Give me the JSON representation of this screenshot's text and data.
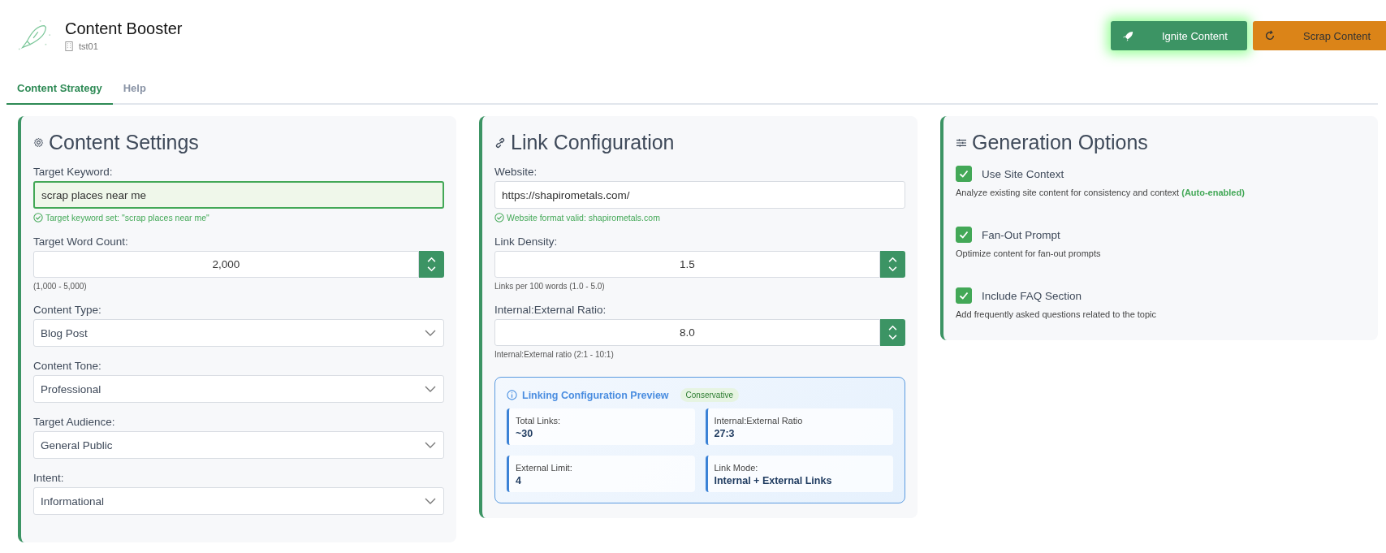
{
  "header": {
    "title": "Content Booster",
    "workspace": "tst01"
  },
  "actions": [
    {
      "label": "Ignite Content",
      "kind": "primary"
    },
    {
      "label": "Scrap Content",
      "kind": "warning"
    }
  ],
  "tabs": [
    {
      "label": "Content Strategy",
      "selected": true
    },
    {
      "label": "Help",
      "selected": false
    }
  ],
  "content_settings": {
    "title": "Content Settings",
    "fields": [
      {
        "kind": "text",
        "label": "Target Keyword:",
        "value": "scrap places near me",
        "focused": true,
        "message": "Target keyword set: \"scrap places near me\""
      },
      {
        "kind": "number",
        "label": "Target Word Count:",
        "value": "2,000",
        "hint": "(1,000 - 5,000)"
      },
      {
        "kind": "select",
        "label": "Content Type:",
        "value": "Blog Post"
      },
      {
        "kind": "select",
        "label": "Content Tone:",
        "value": "Professional"
      },
      {
        "kind": "select",
        "label": "Target Audience:",
        "value": "General Public"
      },
      {
        "kind": "select",
        "label": "Intent:",
        "value": "Informational"
      }
    ]
  },
  "link_configuration": {
    "title": "Link Configuration",
    "fields": [
      {
        "kind": "text",
        "label": "Website:",
        "value": "https://shapirometals.com/",
        "focused": false,
        "message": "Website format valid: shapirometals.com"
      },
      {
        "kind": "number",
        "label": "Link Density:",
        "value": "1.5",
        "hint": "Links per 100 words (1.0 - 5.0)"
      },
      {
        "kind": "number",
        "label": "Internal:External Ratio:",
        "value": "8.0",
        "hint": "Internal:External ratio (2:1 - 10:1)"
      }
    ],
    "preview": {
      "title": "Linking Configuration Preview",
      "badge": "Conservative",
      "stats": [
        {
          "label": "Total Links:",
          "value": "~30"
        },
        {
          "label": "Internal:External Ratio",
          "value": "27:3"
        },
        {
          "label": "External Limit:",
          "value": "4"
        },
        {
          "label": "Link Mode:",
          "value": "Internal + External Links"
        }
      ]
    }
  },
  "generation_options": {
    "title": "Generation Options",
    "options": [
      {
        "label": "Use Site Context",
        "checked": true,
        "description": "Analyze existing site content for consistency and context **(Auto-enabled)**"
      },
      {
        "label": "Fan-Out Prompt",
        "checked": true,
        "description": "Optimize content for fan-out prompts"
      },
      {
        "label": "Include FAQ Section",
        "checked": true,
        "description": "Add frequently asked questions related to the topic"
      }
    ]
  }
}
